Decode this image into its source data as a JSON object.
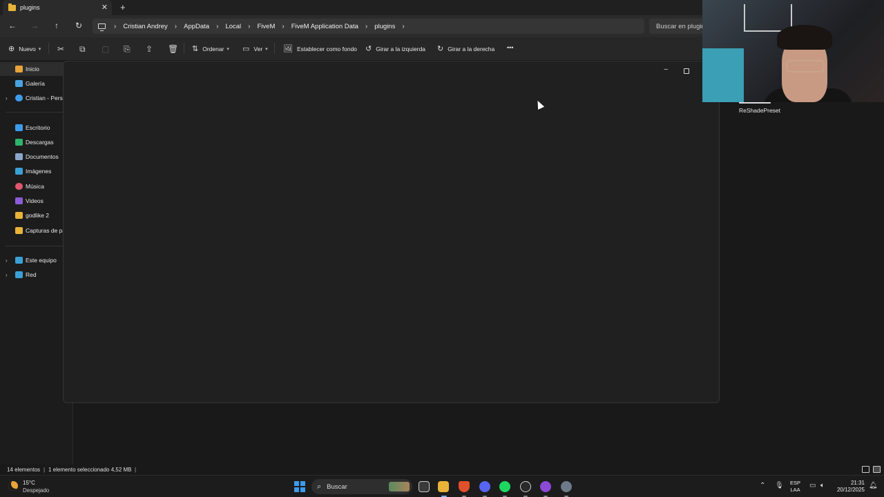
{
  "tab": {
    "title": "plugins",
    "close": "✕",
    "new": "+"
  },
  "nav": {
    "back": "←",
    "forward": "→",
    "up": "↑",
    "refresh": "↻"
  },
  "breadcrumb": {
    "items": [
      "Cristian Andrey",
      "AppData",
      "Local",
      "FiveM",
      "FiveM Application Data",
      "plugins"
    ],
    "sep": "›"
  },
  "search": {
    "placeholder": "Buscar en plugins"
  },
  "toolbar": {
    "new_label": "Nuevo",
    "sort_label": "Ordenar",
    "view_label": "Ver",
    "set_background_label": "Establecer como fondo",
    "rotate_left_label": "Girar a la izquierda",
    "rotate_right_label": "Girar a la derecha",
    "more_label": "•••"
  },
  "sidebar": {
    "items": [
      {
        "label": "Inicio",
        "icon": "home-icon",
        "color": "#e8a33a"
      },
      {
        "label": "Galería",
        "icon": "gallery-icon",
        "color": "#4aa3df"
      },
      {
        "label": "Cristian - Personal",
        "icon": "cloud-icon",
        "color": "#3d9bea"
      },
      {
        "label": "Escritorio",
        "icon": "desktop-icon",
        "color": "#3d9bea"
      },
      {
        "label": "Descargas",
        "icon": "download-icon",
        "color": "#2fb36b"
      },
      {
        "label": "Documentos",
        "icon": "document-icon",
        "color": "#8aa7c9"
      },
      {
        "label": "Imágenes",
        "icon": "image-icon",
        "color": "#3aa0d6"
      },
      {
        "label": "Música",
        "icon": "music-icon",
        "color": "#e0576b"
      },
      {
        "label": "Videos",
        "icon": "video-icon",
        "color": "#8b5cd6"
      },
      {
        "label": "godlike 2",
        "icon": "folder-icon",
        "color": "#e8b339"
      },
      {
        "label": "Capturas de pantalla",
        "icon": "folder-icon",
        "color": "#e8b339"
      },
      {
        "label": "Este equipo",
        "icon": "pc-icon",
        "color": "#3aa0d6"
      },
      {
        "label": "Red",
        "icon": "network-icon",
        "color": "#3aa0d6"
      }
    ]
  },
  "content": {
    "visible_file": "ReShadePreset"
  },
  "status": {
    "count": "14 elementos",
    "selection": "1 elemento seleccionado  4,52 MB",
    "sep": "|"
  },
  "taskbar": {
    "weather_temp": "15°C",
    "weather_desc": "Despejado",
    "search_label": "Buscar",
    "lang_line1": "ESP",
    "lang_line2": "LAA",
    "time": "21:31",
    "date": "20/12/2025"
  }
}
